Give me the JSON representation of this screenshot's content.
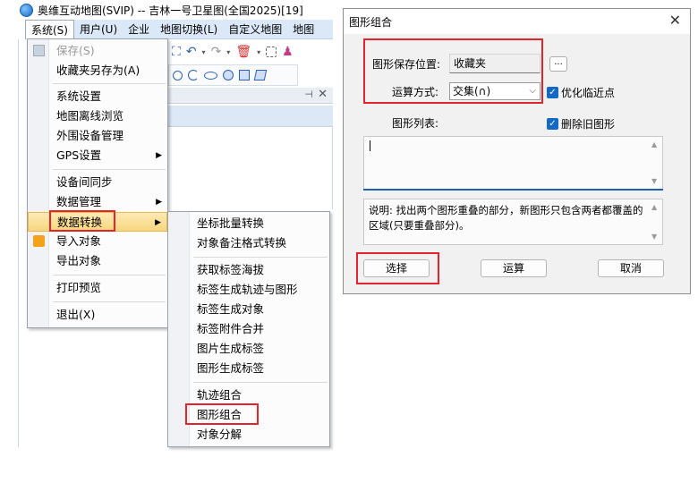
{
  "app": {
    "title": "奥维互动地图(SVIP) -- 吉林一号卫星图(全国2025)[19]",
    "menubar": [
      "系统(S)",
      "用户(U)",
      "企业",
      "地图切换(L)",
      "自定义地图",
      "地图"
    ]
  },
  "system_menu": {
    "items": [
      {
        "label": "保存(S)",
        "disabled": true
      },
      {
        "label": "收藏夹另存为(A)"
      },
      {
        "label": "系统设置"
      },
      {
        "label": "地图离线浏览"
      },
      {
        "label": "外围设备管理"
      },
      {
        "label": "GPS设置",
        "submenu": true
      },
      {
        "label": "设备间同步"
      },
      {
        "label": "数据管理",
        "submenu": true
      },
      {
        "label": "数据转换",
        "submenu": true,
        "highlighted": true
      },
      {
        "label": "导入对象"
      },
      {
        "label": "导出对象"
      },
      {
        "label": "打印预览"
      },
      {
        "label": "退出(X)"
      }
    ]
  },
  "convert_submenu": {
    "items": [
      {
        "label": "坐标批量转换"
      },
      {
        "label": "对象备注格式转换"
      },
      {
        "label": "获取标签海拔"
      },
      {
        "label": "标签生成轨迹与图形"
      },
      {
        "label": "标签生成对象"
      },
      {
        "label": "标签附件合并"
      },
      {
        "label": "图片生成标签"
      },
      {
        "label": "图形生成标签"
      },
      {
        "label": "轨迹组合"
      },
      {
        "label": "图形组合",
        "boxed": true
      },
      {
        "label": "对象分解"
      }
    ]
  },
  "dialog": {
    "title": "图形组合",
    "save_location_label": "图形保存位置:",
    "save_location_value": "收藏夹",
    "browse_button": "...",
    "operation_label": "运算方式:",
    "operation_value": "交集(∩)",
    "optimize_checkbox": "优化临近点",
    "shape_list_label": "图形列表:",
    "delete_old_checkbox": "删除旧图形",
    "description": "说明: 找出两个图形重叠的部分，新图形只包含两者都覆盖的区域(只要重叠部分)。",
    "buttons": {
      "select": "选择",
      "compute": "运算",
      "cancel": "取消"
    }
  },
  "colors": {
    "highlight_border": "#e2252b",
    "accent": "#1468c6"
  }
}
